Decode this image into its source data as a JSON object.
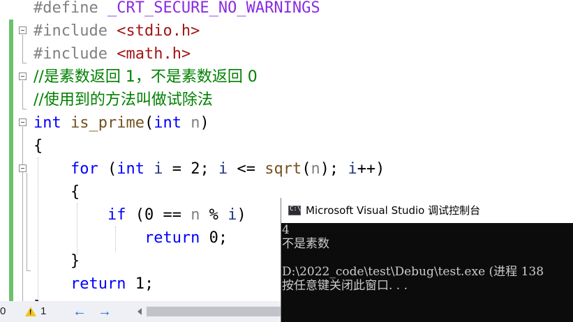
{
  "editor": {
    "lines": [
      {
        "tokens": [
          {
            "t": "#define ",
            "c": "c-pp"
          },
          {
            "t": "_CRT_SECURE_NO_WARNINGS",
            "c": "c-macro"
          }
        ]
      },
      {
        "tokens": [
          {
            "t": "#include ",
            "c": "c-pp"
          },
          {
            "t": "<stdio.h>",
            "c": "c-str"
          }
        ]
      },
      {
        "tokens": [
          {
            "t": "#include ",
            "c": "c-pp"
          },
          {
            "t": "<math.h>",
            "c": "c-str"
          }
        ]
      },
      {
        "tokens": [
          {
            "t": "//是素数返回 1，不是素数返回 0",
            "c": "c-cmt"
          }
        ]
      },
      {
        "tokens": [
          {
            "t": "//使用到的方法叫做试除法",
            "c": "c-cmt"
          }
        ]
      },
      {
        "tokens": [
          {
            "t": "int",
            "c": "c-kw"
          },
          {
            "t": " ",
            "c": "c-plain"
          },
          {
            "t": "is_prime",
            "c": "c-fn"
          },
          {
            "t": "(",
            "c": "c-plain"
          },
          {
            "t": "int",
            "c": "c-kw"
          },
          {
            "t": " ",
            "c": "c-plain"
          },
          {
            "t": "n",
            "c": "c-param"
          },
          {
            "t": ")",
            "c": "c-plain"
          }
        ]
      },
      {
        "tokens": [
          {
            "t": "{",
            "c": "c-plain"
          }
        ]
      },
      {
        "tokens": [
          {
            "t": "    ",
            "c": "c-plain"
          },
          {
            "t": "for",
            "c": "c-kw"
          },
          {
            "t": " (",
            "c": "c-plain"
          },
          {
            "t": "int",
            "c": "c-kw"
          },
          {
            "t": " ",
            "c": "c-plain"
          },
          {
            "t": "i",
            "c": "c-var"
          },
          {
            "t": " = 2; ",
            "c": "c-plain"
          },
          {
            "t": "i",
            "c": "c-var"
          },
          {
            "t": " <= ",
            "c": "c-plain"
          },
          {
            "t": "sqrt",
            "c": "c-fn"
          },
          {
            "t": "(",
            "c": "c-plain"
          },
          {
            "t": "n",
            "c": "c-param"
          },
          {
            "t": "); ",
            "c": "c-plain"
          },
          {
            "t": "i",
            "c": "c-var"
          },
          {
            "t": "++)",
            "c": "c-plain"
          }
        ]
      },
      {
        "tokens": [
          {
            "t": "    {",
            "c": "c-plain"
          }
        ]
      },
      {
        "tokens": [
          {
            "t": "        ",
            "c": "c-plain"
          },
          {
            "t": "if",
            "c": "c-kw"
          },
          {
            "t": " (0 == ",
            "c": "c-plain"
          },
          {
            "t": "n",
            "c": "c-param"
          },
          {
            "t": " % ",
            "c": "c-plain"
          },
          {
            "t": "i",
            "c": "c-var"
          },
          {
            "t": ")",
            "c": "c-plain"
          }
        ]
      },
      {
        "tokens": [
          {
            "t": "            ",
            "c": "c-plain"
          },
          {
            "t": "return",
            "c": "c-kw"
          },
          {
            "t": " 0;",
            "c": "c-plain"
          }
        ]
      },
      {
        "tokens": [
          {
            "t": "    }",
            "c": "c-plain"
          }
        ]
      },
      {
        "tokens": [
          {
            "t": "    ",
            "c": "c-plain"
          },
          {
            "t": "return",
            "c": "c-kw"
          },
          {
            "t": " 1;",
            "c": "c-plain"
          }
        ]
      },
      {
        "tokens": [
          {
            "t": "}",
            "c": "c-plain"
          }
        ]
      }
    ]
  },
  "statusbar": {
    "errors_count": "0",
    "warnings_count": "1",
    "back_glyph": "←",
    "forward_glyph": "→",
    "accent_color": "#1a6fd1"
  },
  "console": {
    "icon_text": "C:\\",
    "title": "Microsoft Visual Studio 调试控制台",
    "lines": [
      "4",
      "不是素数",
      "",
      "D:\\2022_code\\test\\Debug\\test.exe (进程 138",
      "按任意键关闭此窗口. . ."
    ]
  }
}
